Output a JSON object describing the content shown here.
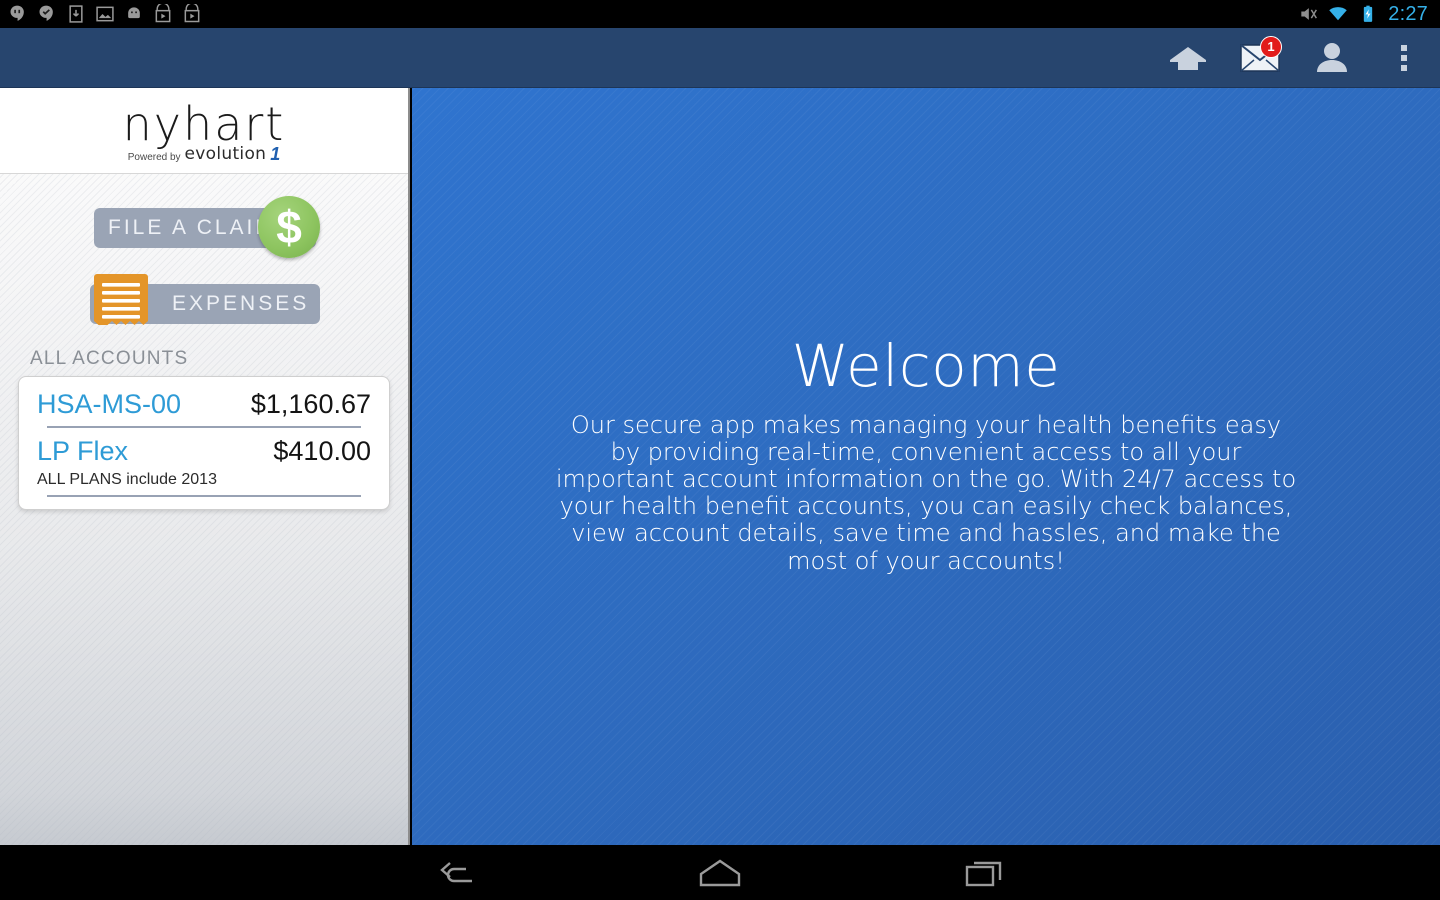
{
  "statusbar": {
    "notification_icons": [
      "hangouts-icon",
      "chat-check-icon",
      "download-icon",
      "image-icon",
      "android-icon",
      "play-store-icon",
      "play-store-icon-2"
    ],
    "mute_icon": "mute-icon",
    "wifi_icon": "wifi-icon",
    "battery_icon": "battery-charging-icon",
    "clock": "2:27",
    "clock_color": "#35b0e8"
  },
  "actionbar": {
    "background": "#27456e",
    "home_icon": "home-icon",
    "messages_icon": "envelope-icon",
    "messages_badge": "1",
    "badge_color": "#e21b1b",
    "profile_icon": "person-icon",
    "overflow_icon": "overflow-menu-icon"
  },
  "sidebar": {
    "logo": {
      "wordmark": "nyhart",
      "powered_by": "Powered by",
      "brand": "evolution",
      "brand_mark": "1"
    },
    "actions": [
      {
        "label": "FILE A CLAIM",
        "icon": "dollar-coin-icon",
        "icon_color": "#8dc45f",
        "glyph": "$"
      },
      {
        "label": "EXPENSES",
        "icon": "receipt-icon",
        "icon_color": "#e49529"
      }
    ],
    "accounts_label": "ALL ACCOUNTS",
    "accounts": [
      {
        "name": "HSA-MS-00",
        "amount": "$1,160.67",
        "note": ""
      },
      {
        "name": "LP Flex",
        "amount": "$410.00",
        "note": "ALL PLANS include 2013"
      }
    ],
    "account_name_color": "#2e9bd6"
  },
  "main": {
    "title": "Welcome",
    "body": "Our secure app makes managing your health benefits easy by providing real-time, convenient access to all your important account information on the go. With 24/7 access to your health benefit accounts, you can easily check balances, view account details, save time and hassles, and make the most of your accounts!",
    "background": "#2e6cc0"
  },
  "navbar": {
    "back_icon": "back-icon",
    "home_icon": "home-icon",
    "recents_icon": "recents-icon"
  }
}
